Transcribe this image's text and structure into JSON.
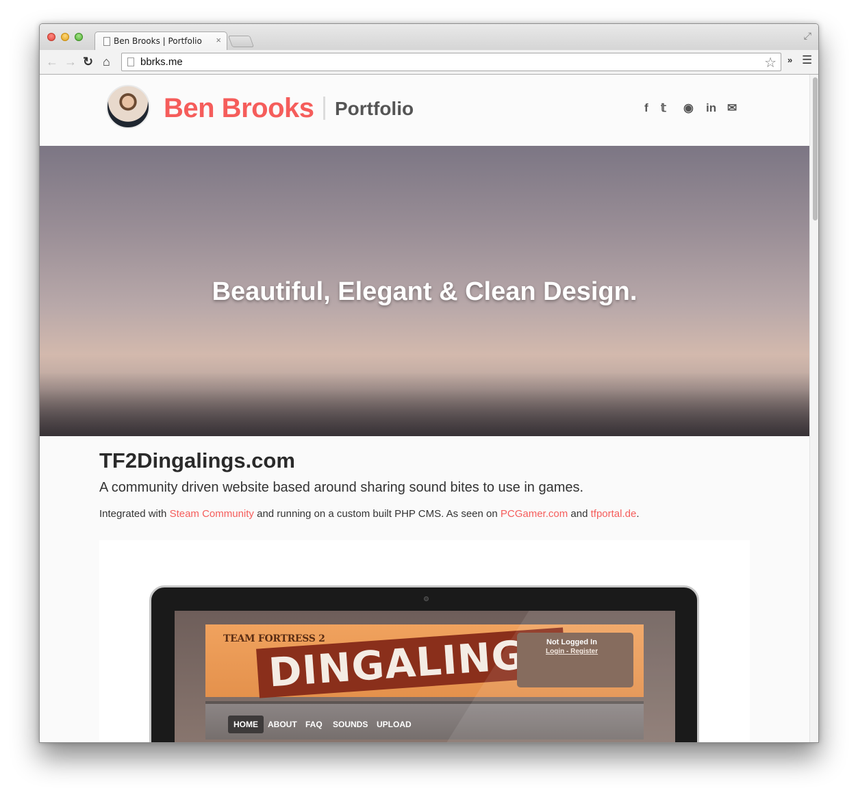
{
  "browser": {
    "tab_title": "Ben Brooks | Portfolio",
    "tab_close": "×",
    "url": "bbrks.me"
  },
  "header": {
    "name": "Ben Brooks",
    "subtitle": "Portfolio",
    "social_icons": [
      "facebook-icon",
      "twitter-icon",
      "github-icon",
      "linkedin-icon",
      "mail-icon"
    ],
    "social_glyphs": [
      "f",
      "𝕥",
      "◉",
      "in",
      "✉"
    ]
  },
  "hero": {
    "headline": "Beautiful, Elegant & Clean Design."
  },
  "project": {
    "title": "TF2Dingalings.com",
    "description": "A community driven website based around sharing sound bites to use in games.",
    "meta_prefix": "Integrated with ",
    "link_steam": "Steam Community",
    "meta_middle": " and running on a custom built PHP CMS. As seen on ",
    "link_pcgamer": "PCGamer.com",
    "meta_and": " and ",
    "link_tfportal": "tfportal.de",
    "meta_suffix": "."
  },
  "mockup": {
    "tf2_label": "TEAM FORTRESS 2",
    "logo_text": "DINGALINGS",
    "login_status": "Not Logged In",
    "login_links": "Login - Register",
    "nav": [
      "HOME",
      "ABOUT",
      "FAQ",
      "SOUNDS",
      "UPLOAD"
    ]
  },
  "colors": {
    "accent": "#f55d5b",
    "subtitle": "#555555"
  }
}
